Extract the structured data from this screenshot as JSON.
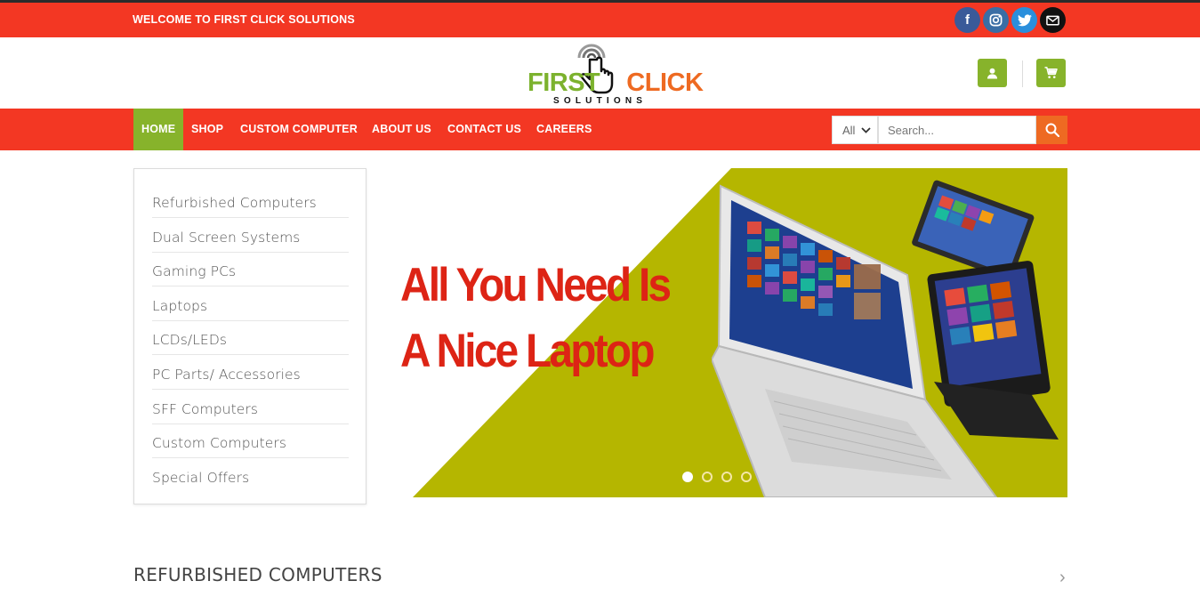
{
  "topbar": {
    "welcome": "WELCOME TO FIRST CLICK SOLUTIONS",
    "social": [
      {
        "icon": "facebook-icon",
        "glyph": "f",
        "color": "#3a5a99"
      },
      {
        "icon": "instagram-icon",
        "color": "#3a6ea5"
      },
      {
        "icon": "twitter-icon",
        "color": "#2a8fdc"
      },
      {
        "icon": "email-icon",
        "color": "#111111"
      }
    ]
  },
  "logo": {
    "word1": "FIRST",
    "word2": "CLICK",
    "sub": "SOLUTIONS"
  },
  "header": {
    "account_icon": "user-icon",
    "cart_icon": "cart-icon"
  },
  "nav": {
    "items": [
      "HOME",
      "SHOP",
      "CUSTOM COMPUTER",
      "ABOUT US",
      "CONTACT US",
      "CAREERS"
    ],
    "active": "HOME"
  },
  "search": {
    "category": "All",
    "placeholder": "Search..."
  },
  "categories": [
    "Refurbished Computers",
    "Dual Screen Systems",
    "Gaming PCs",
    "Laptops",
    "LCDs/LEDs",
    "PC Parts/ Accessories",
    "SFF Computers",
    "Custom Computers",
    "Special Offers"
  ],
  "slider": {
    "headline_line1": "All You Need Is",
    "headline_line2": "A Nice Laptop",
    "slide_count": 4,
    "active_slide": 1
  },
  "section": {
    "title": "REFURBISHED COMPUTERS",
    "arrow": "›"
  },
  "colors": {
    "primary_red": "#f33723",
    "green": "#87b32b",
    "orange": "#ee6a22",
    "slider_bg": "#b5b600",
    "headline_red": "#dd2415"
  }
}
